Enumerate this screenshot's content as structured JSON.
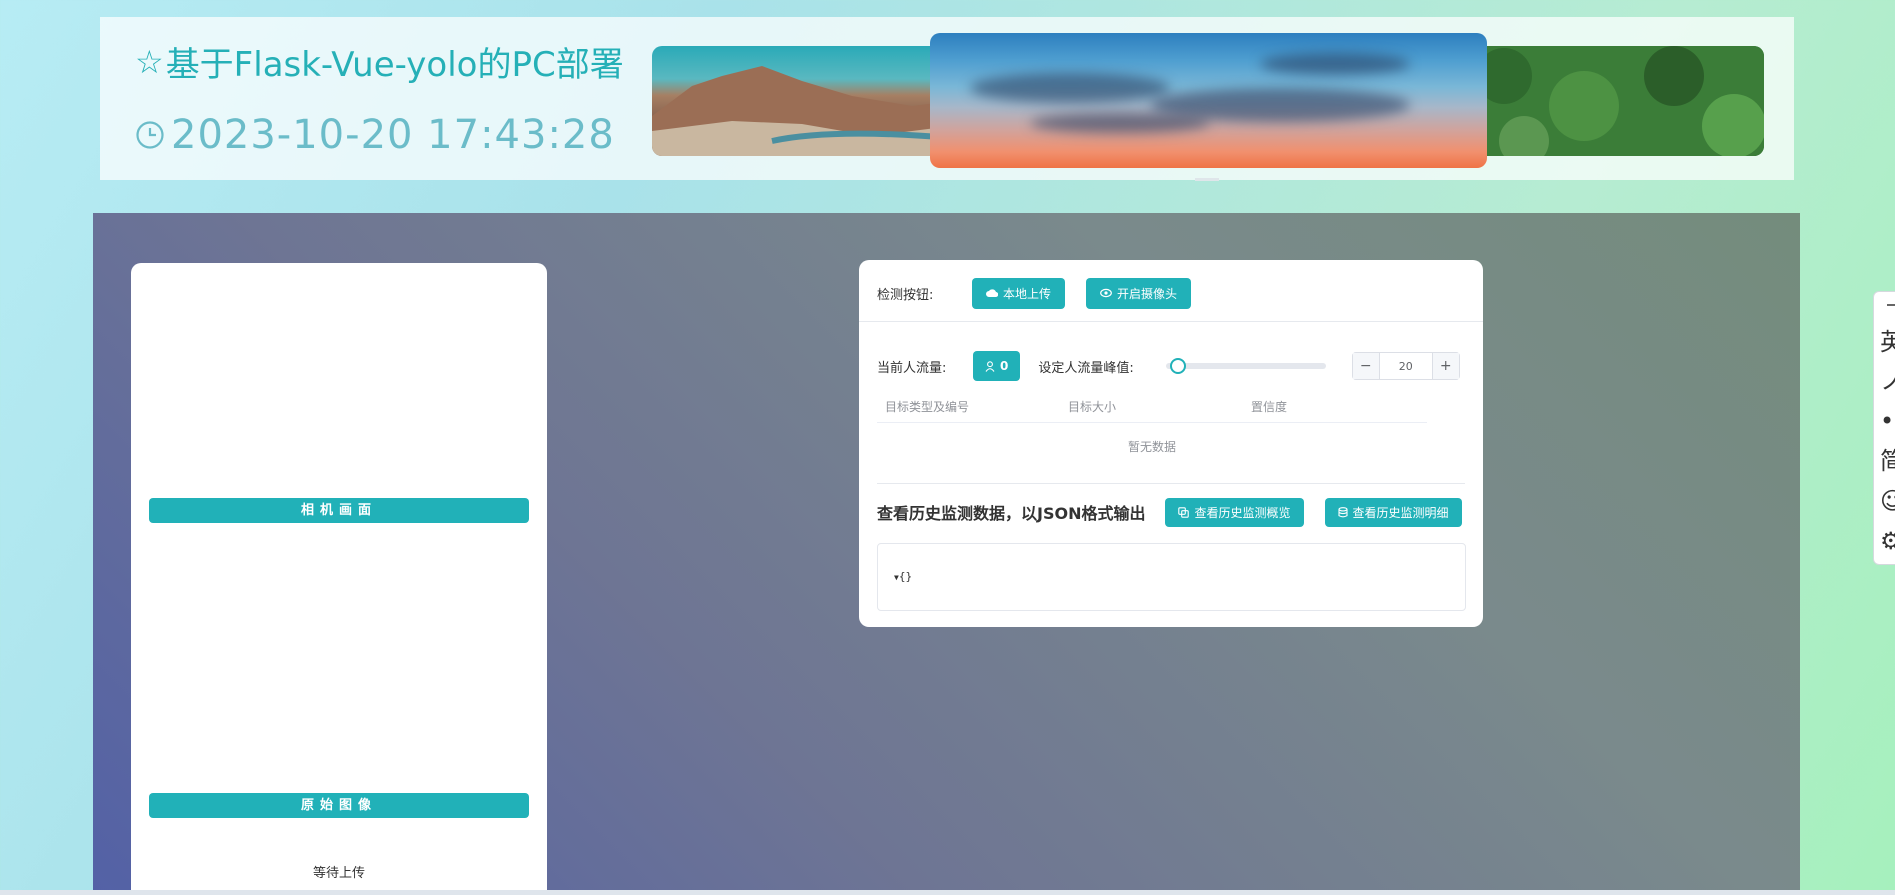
{
  "header": {
    "title": "基于Flask-Vue-yolo的PC部署",
    "datetime": "2023-10-20 17:43:28",
    "title_icon": "star-outline-icon",
    "clock_icon": "clock-icon"
  },
  "carousel": {
    "slides": [
      "desert-canyon-landscape",
      "sunset-sky-clouds",
      "green-forest-aerial"
    ]
  },
  "left_panel": {
    "camera_label": "相机画面",
    "original_label": "原始图像",
    "status": "等待上传"
  },
  "right_panel": {
    "detect_label": "检测按钮:",
    "upload_button": "本地上传",
    "camera_button": "开启摄像头",
    "current_flow_label": "当前人流量:",
    "current_flow_value": "0",
    "peak_label": "设定人流量峰值:",
    "slider_value": 0,
    "stepper_minus": "−",
    "stepper_value": "20",
    "stepper_plus": "+",
    "table": {
      "columns": [
        "目标类型及编号",
        "目标大小",
        "置信度"
      ],
      "empty_text": "暂无数据"
    },
    "history_title": "查看历史监测数据，以JSON格式输出",
    "history_overview_button": "查看历史监测概览",
    "history_detail_button": "查看历史监测明细",
    "json_output": "{}"
  },
  "side_toolbar": {
    "items": [
      "英",
      "ノ",
      "•",
      "简",
      "☺",
      "⚙"
    ]
  },
  "colors": {
    "accent": "#21b1b8",
    "title": "#25b0b7"
  }
}
